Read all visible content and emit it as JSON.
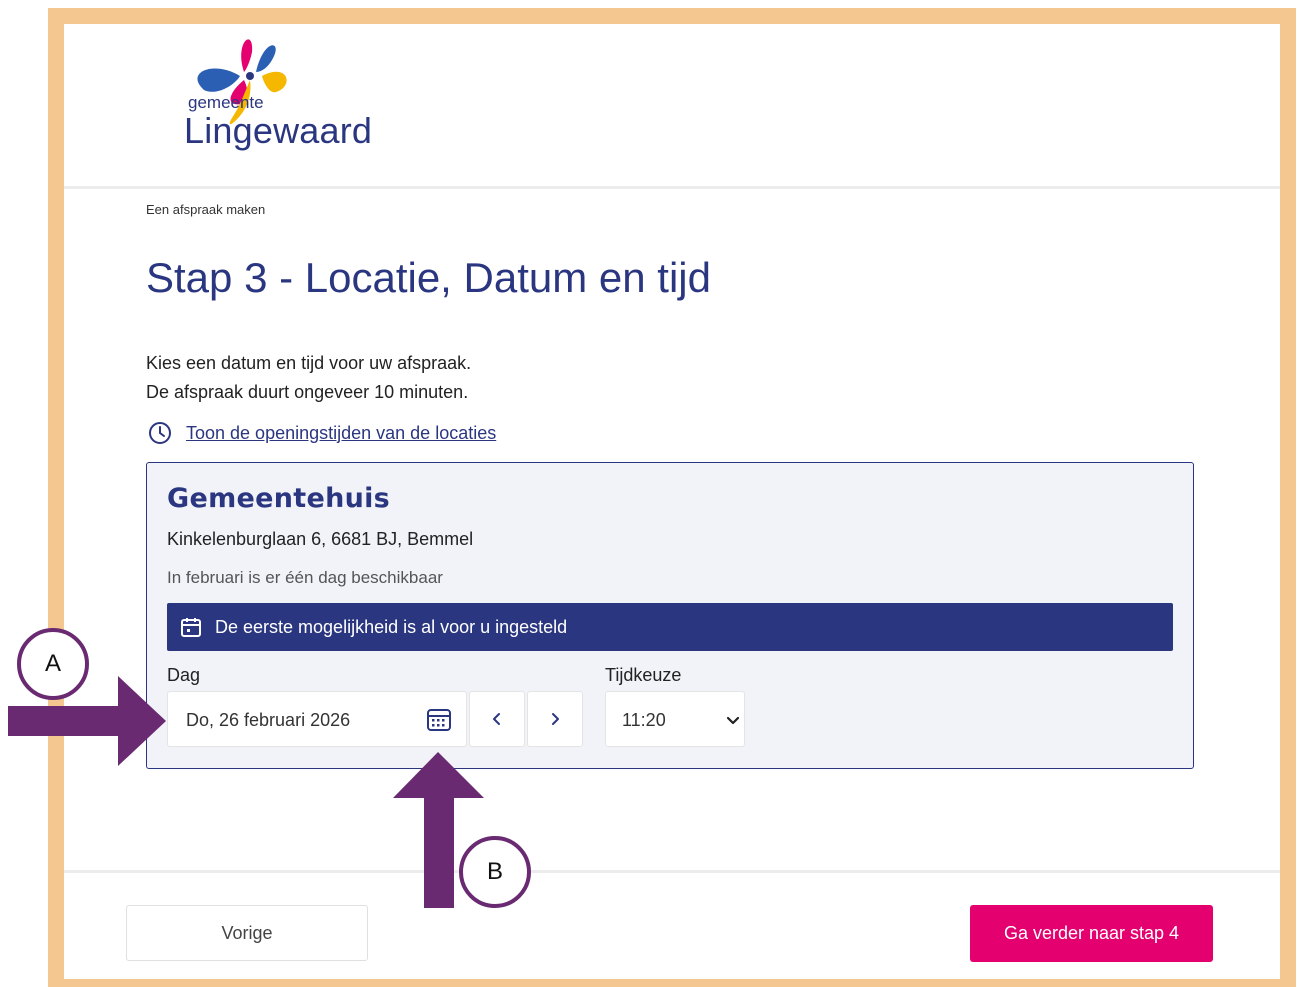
{
  "header": {
    "logo_small": "gemeente",
    "logo_big": "Lingewaard",
    "logo_icon": "butterfly-logo"
  },
  "breadcrumb": "Een afspraak maken",
  "title": "Stap 3 - Locatie, Datum en tijd",
  "intro": {
    "line1": "Kies een datum en tijd voor uw afspraak.",
    "line2": "De afspraak duurt ongeveer 10 minuten."
  },
  "opening_hours_link": {
    "icon": "clock-icon",
    "label": "Toon de openingstijden van de locaties"
  },
  "location": {
    "name": "Gemeentehuis",
    "address": "Kinkelenburglaan 6, 6681 BJ, Bemmel",
    "availability": "In februari is er één dag beschikbaar",
    "banner": {
      "icon": "calendar-icon",
      "text": "De eerste mogelijkheid is al voor u ingesteld"
    },
    "day_field": {
      "label": "Dag",
      "value": "Do, 26 februari 2026",
      "icon": "calendar-grid-icon"
    },
    "nav": {
      "prev_icon": "chevron-left-icon",
      "next_icon": "chevron-right-icon"
    },
    "time_field": {
      "label": "Tijdkeuze",
      "value": "11:20",
      "icon": "chevron-down-icon"
    }
  },
  "footer": {
    "prev_label": "Vorige",
    "next_label": "Ga verder naar stap 4"
  },
  "annotations": {
    "a_label": "A",
    "b_label": "B"
  },
  "colors": {
    "brand_blue": "#2b3681",
    "primary_button": "#e4006f",
    "frame": "#f4c690",
    "annotation_arrow": "#6a2a72"
  }
}
